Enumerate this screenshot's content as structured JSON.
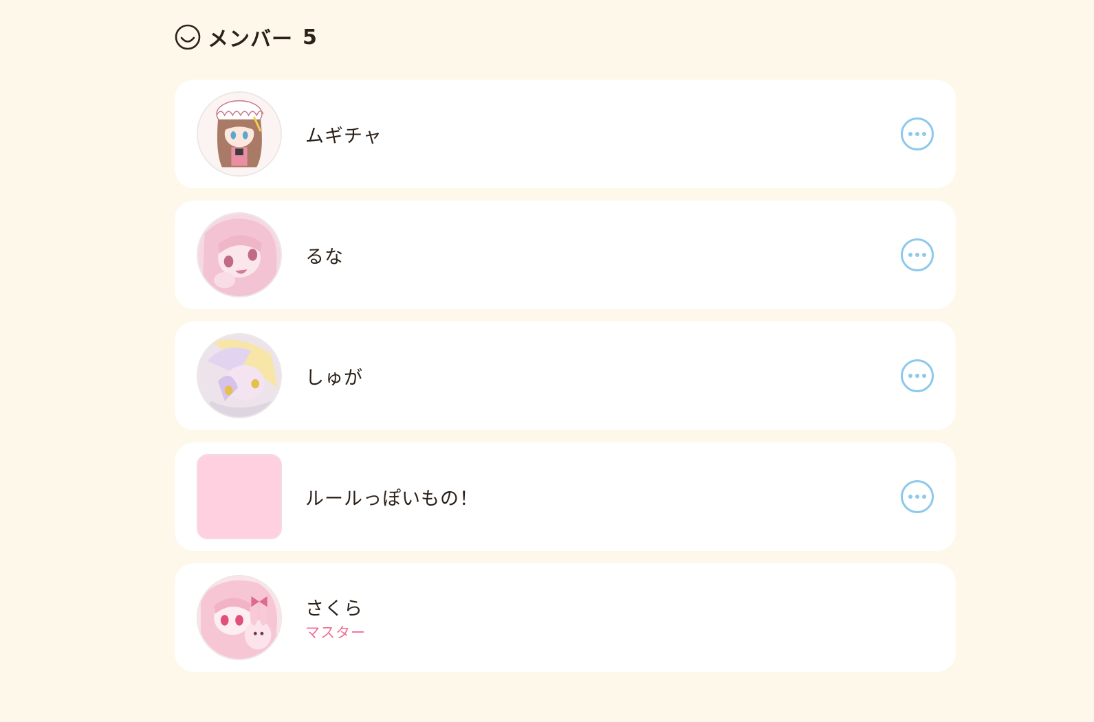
{
  "header": {
    "icon": "smile-icon",
    "title": "メンバー",
    "count": "5"
  },
  "colors": {
    "background": "#fdf8ea",
    "card": "#ffffff",
    "accent_blue": "#8cc9ec",
    "role_pink": "#f06e94",
    "avatar_pink": "#ffd1e0"
  },
  "members": [
    {
      "name": "ムギチャ",
      "role": "",
      "avatar": "anime-girl-brown-hair-avatar",
      "has_menu": true
    },
    {
      "name": "るな",
      "role": "",
      "avatar": "anime-girl-pink-hair-avatar",
      "has_menu": true
    },
    {
      "name": "しゅが",
      "role": "",
      "avatar": "anime-girl-pastel-yellow-avatar",
      "has_menu": true
    },
    {
      "name": "ルールっぽいもの！",
      "role": "",
      "avatar": "pink-square-avatar",
      "has_menu": true
    },
    {
      "name": "さくら",
      "role": "マスター",
      "avatar": "anime-girl-pink-bunny-avatar",
      "has_menu": false
    }
  ]
}
